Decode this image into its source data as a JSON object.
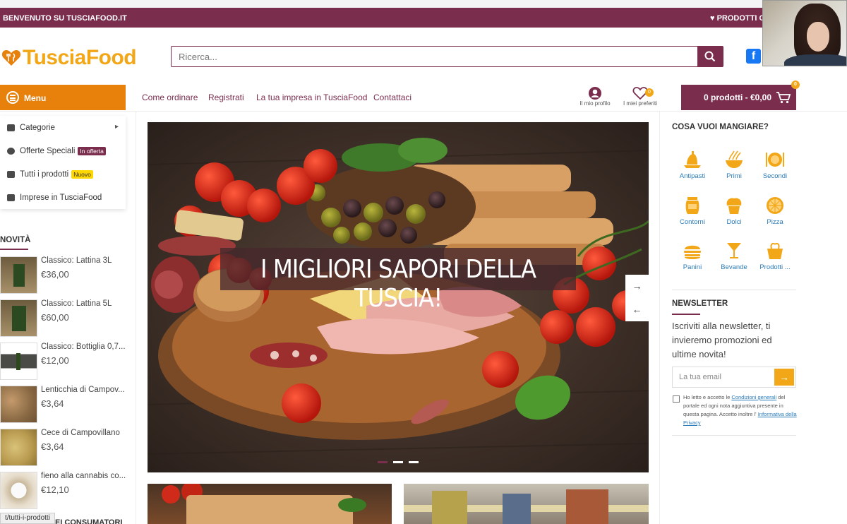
{
  "topbar": {
    "welcome": "BENVENUTO SU TUSCIAFOOD.IT",
    "products_link": "PRODOTTI O"
  },
  "header": {
    "logo_text": "TusciaFood",
    "search_placeholder": "Ricerca...",
    "search_icon": "search-icon",
    "social_icon": "facebook-icon"
  },
  "nav": {
    "menu_label": "Menu",
    "links": [
      "Come ordinare",
      "Registrati",
      "La tua impresa in TusciaFood",
      "Contattaci"
    ],
    "profile_label": "Il mio profilo",
    "favorites_label": "I miei preferiti",
    "favorites_count": "0",
    "cart_label": "0 prodotti - €0,00",
    "cart_count": "0"
  },
  "dropdown": {
    "items": [
      {
        "label": "Categorie",
        "icon": "shop-icon",
        "tag": ""
      },
      {
        "label": "Offerte Speciali",
        "icon": "percent-icon",
        "tag": "In offerta"
      },
      {
        "label": "Tutti i prodotti",
        "icon": "list-icon",
        "tag": "Nuovo"
      },
      {
        "label": "Imprese in TusciaFood",
        "icon": "store-icon",
        "tag": ""
      }
    ]
  },
  "novita": {
    "title": "NOVITÀ",
    "products": [
      {
        "name": "Classico: Lattina 3L",
        "price": "€36,00"
      },
      {
        "name": "Classico: Lattina 5L",
        "price": "€60,00"
      },
      {
        "name": "Classico: Bottiglia 0,7...",
        "price": "€12,00"
      },
      {
        "name": "Lenticchia di Campov...",
        "price": "€3,64"
      },
      {
        "name": "Cece di Campovillano",
        "price": "€3,64"
      },
      {
        "name": "fieno alla cannabis co...",
        "price": "€12,10"
      }
    ]
  },
  "status_url": "t/tutti-i-prodotti",
  "bottom_section_title": "DEI CONSUMATORI",
  "hero": {
    "caption": "I MIGLIORI SAPORI DELLA TUSCIA!",
    "next_icon": "arrow-right-icon",
    "prev_icon": "arrow-left-icon",
    "dots": 3,
    "active_dot": 1
  },
  "right_sidebar": {
    "categories_title": "COSA VUOI MANGIARE?",
    "categories": [
      {
        "label": "Antipasti",
        "icon": "antipasti-icon"
      },
      {
        "label": "Primi",
        "icon": "pasta-icon"
      },
      {
        "label": "Secondi",
        "icon": "plate-icon"
      },
      {
        "label": "Contorni",
        "icon": "jar-icon"
      },
      {
        "label": "Dolci",
        "icon": "cupcake-icon"
      },
      {
        "label": "Pizza",
        "icon": "pizza-icon"
      },
      {
        "label": "Panini",
        "icon": "burger-icon"
      },
      {
        "label": "Bevande",
        "icon": "cocktail-icon"
      },
      {
        "label": "Prodotti ...",
        "icon": "basket-icon"
      }
    ],
    "newsletter_title": "NEWSLETTER",
    "newsletter_text": "Iscriviti alla newsletter, ti invieremo promozioni ed ultime novita!",
    "email_placeholder": "La tua email",
    "privacy_prefix": "Ho letto e accetto le",
    "privacy_link1": "Condizioni generali",
    "privacy_mid": "del portale ed ogni nota aggiuntiva presente in questa pagina. Accetto inoltre l'",
    "privacy_link2": "Informativa della Privacy"
  },
  "colors": {
    "brand": "#7b2d4e",
    "accent": "#e8800c",
    "gold": "#f2a718",
    "link": "#2a7bb9"
  }
}
